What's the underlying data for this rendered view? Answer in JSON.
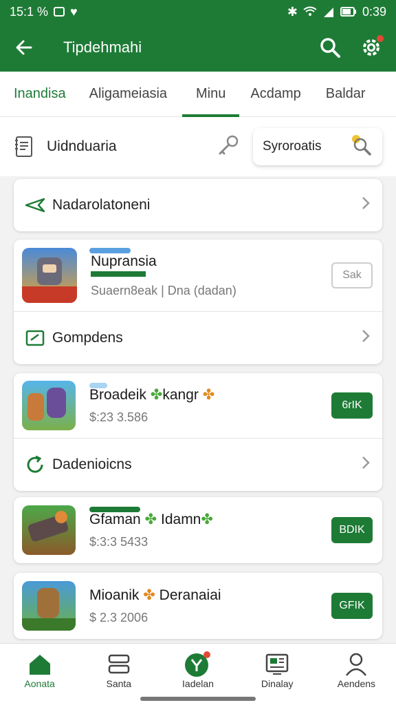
{
  "status_bar": {
    "time_left": "15:1 %",
    "time_right": "0:39"
  },
  "app_bar": {
    "title": "Tipdehmahi"
  },
  "tabs": [
    {
      "label": "Inandisa"
    },
    {
      "label": "Aligameiasia"
    },
    {
      "label": "Minu"
    },
    {
      "label": "Acdamp"
    },
    {
      "label": "Baldar"
    }
  ],
  "search": {
    "label": "Uidnduaria",
    "pill_text": "Syroroatis"
  },
  "cards": {
    "card1_nav": {
      "label": "Nadarolatoneni"
    },
    "app1": {
      "name": "Nupransia",
      "sub": "Suaern8eak | Dna (dadan)",
      "button": "Sak"
    },
    "nav2": {
      "label": "Gompdens"
    },
    "app2": {
      "name": "Broadeik",
      "name2": "kangr",
      "sub": "$:23 3.586",
      "button": "6rIK"
    },
    "nav3": {
      "label": "Dadenioicns"
    },
    "app3": {
      "name": "Gfaman",
      "name2": "Idamn",
      "sub": "$:3:3 5433",
      "button": "BDIK"
    },
    "app4": {
      "name": "Mioanik",
      "name2": "Deranaiai",
      "sub": "$ 2.3 2006",
      "button": "GFIK"
    }
  },
  "bottom_nav": [
    {
      "label": "Aonata"
    },
    {
      "label": "Santa"
    },
    {
      "label": "Iadelan"
    },
    {
      "label": "Dinalay"
    },
    {
      "label": "Aendens"
    }
  ],
  "colors": {
    "primary": "#1e7b36",
    "badge": "#e24a36"
  }
}
